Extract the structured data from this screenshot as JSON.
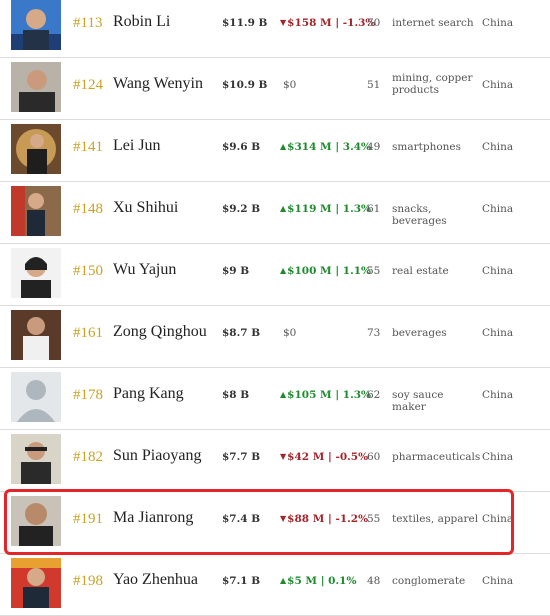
{
  "colors": {
    "rank": "#c9a227",
    "negative": "#a3242a",
    "positive": "#1f8a2d",
    "highlight": "#e4252a"
  },
  "rows": [
    {
      "rank": "#113",
      "name": "Robin Li",
      "net_worth": "$11.9 B",
      "change": "$158 M | -1.3%",
      "direction": "down",
      "age": "50",
      "source": "internet search",
      "country": "China"
    },
    {
      "rank": "#124",
      "name": "Wang Wenyin",
      "net_worth": "$10.9 B",
      "change": "$0",
      "direction": "none",
      "age": "51",
      "source": "mining, copper products",
      "country": "China"
    },
    {
      "rank": "#141",
      "name": "Lei Jun",
      "net_worth": "$9.6 B",
      "change": "$314 M | 3.4%",
      "direction": "up",
      "age": "49",
      "source": "smartphones",
      "country": "China"
    },
    {
      "rank": "#148",
      "name": "Xu Shihui",
      "net_worth": "$9.2 B",
      "change": "$119 M | 1.3%",
      "direction": "up",
      "age": "61",
      "source": "snacks, beverages",
      "country": "China"
    },
    {
      "rank": "#150",
      "name": "Wu Yajun",
      "net_worth": "$9 B",
      "change": "$100 M | 1.1%",
      "direction": "up",
      "age": "55",
      "source": "real estate",
      "country": "China"
    },
    {
      "rank": "#161",
      "name": "Zong Qinghou",
      "net_worth": "$8.7 B",
      "change": "$0",
      "direction": "none",
      "age": "73",
      "source": "beverages",
      "country": "China"
    },
    {
      "rank": "#178",
      "name": "Pang Kang",
      "net_worth": "$8 B",
      "change": "$105 M | 1.3%",
      "direction": "up",
      "age": "62",
      "source": "soy sauce maker",
      "country": "China"
    },
    {
      "rank": "#182",
      "name": "Sun Piaoyang",
      "net_worth": "$7.7 B",
      "change": "$42 M | -0.5%",
      "direction": "down",
      "age": "60",
      "source": "pharmaceuticals",
      "country": "China"
    },
    {
      "rank": "#191",
      "name": "Ma Jianrong",
      "net_worth": "$7.4 B",
      "change": "$88 M | -1.2%",
      "direction": "down",
      "age": "55",
      "source": "textiles, apparel",
      "country": "China"
    },
    {
      "rank": "#198",
      "name": "Yao Zhenhua",
      "net_worth": "$7.1 B",
      "change": "$5 M | 0.1%",
      "direction": "up",
      "age": "48",
      "source": "conglomerate",
      "country": "China"
    }
  ]
}
